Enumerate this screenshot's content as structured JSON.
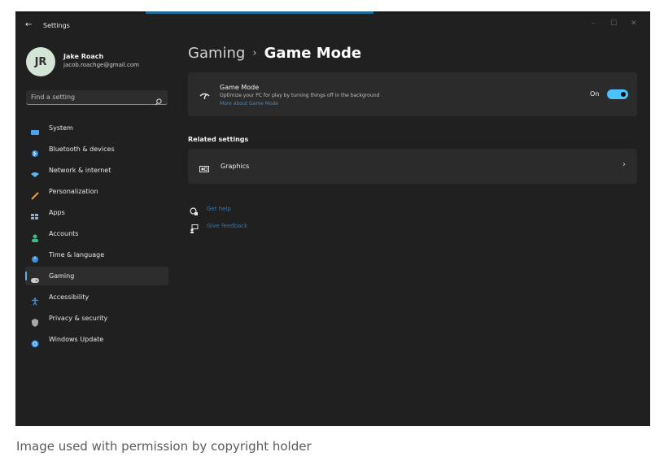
{
  "window": {
    "title": "Settings",
    "back_glyph": "←",
    "controls": {
      "minimize": "–",
      "maximize": "☐",
      "close": "✕"
    }
  },
  "user": {
    "initials": "JR",
    "name": "Jake Roach",
    "email": "jacob.roachge@gmail.com"
  },
  "search": {
    "placeholder": "Find a setting",
    "icon": "search-icon"
  },
  "sidebar": {
    "items": [
      {
        "label": "System",
        "icon": "system-icon",
        "color": "#4aa3f0"
      },
      {
        "label": "Bluetooth & devices",
        "icon": "bluetooth-icon",
        "color": "#2f8fe6"
      },
      {
        "label": "Network & internet",
        "icon": "network-icon",
        "color": "#5db6f2"
      },
      {
        "label": "Personalization",
        "icon": "personalization-icon",
        "color": "#e0a050"
      },
      {
        "label": "Apps",
        "icon": "apps-icon",
        "color": "#9aaabb"
      },
      {
        "label": "Accounts",
        "icon": "accounts-icon",
        "color": "#3dbb8a"
      },
      {
        "label": "Time & language",
        "icon": "time-language-icon",
        "color": "#3d8fd6"
      },
      {
        "label": "Gaming",
        "icon": "gaming-icon",
        "color": "#c8c8c8",
        "selected": true
      },
      {
        "label": "Accessibility",
        "icon": "accessibility-icon",
        "color": "#3a9df0"
      },
      {
        "label": "Privacy & security",
        "icon": "shield-icon",
        "color": "#a8a8a8"
      },
      {
        "label": "Windows Update",
        "icon": "windows-update-icon",
        "color": "#2f8fe6"
      }
    ],
    "accent_color": "#5fb2f2"
  },
  "breadcrumb": {
    "parent": "Gaming",
    "separator": "›",
    "current": "Game Mode"
  },
  "game_mode": {
    "title": "Game Mode",
    "description": "Optimize your PC for play by turning things off in the background",
    "link": "More about Game Mode",
    "toggle_state": "On",
    "toggle_on": true,
    "toggle_color": "#4cc2ff"
  },
  "related": {
    "heading": "Related settings",
    "items": [
      {
        "label": "Graphics",
        "icon": "graphics-icon",
        "chevron": "›"
      }
    ]
  },
  "help": {
    "get_help": "Get help",
    "give_feedback": "Give feedback"
  },
  "caption": "Image used with permission by copyright holder"
}
